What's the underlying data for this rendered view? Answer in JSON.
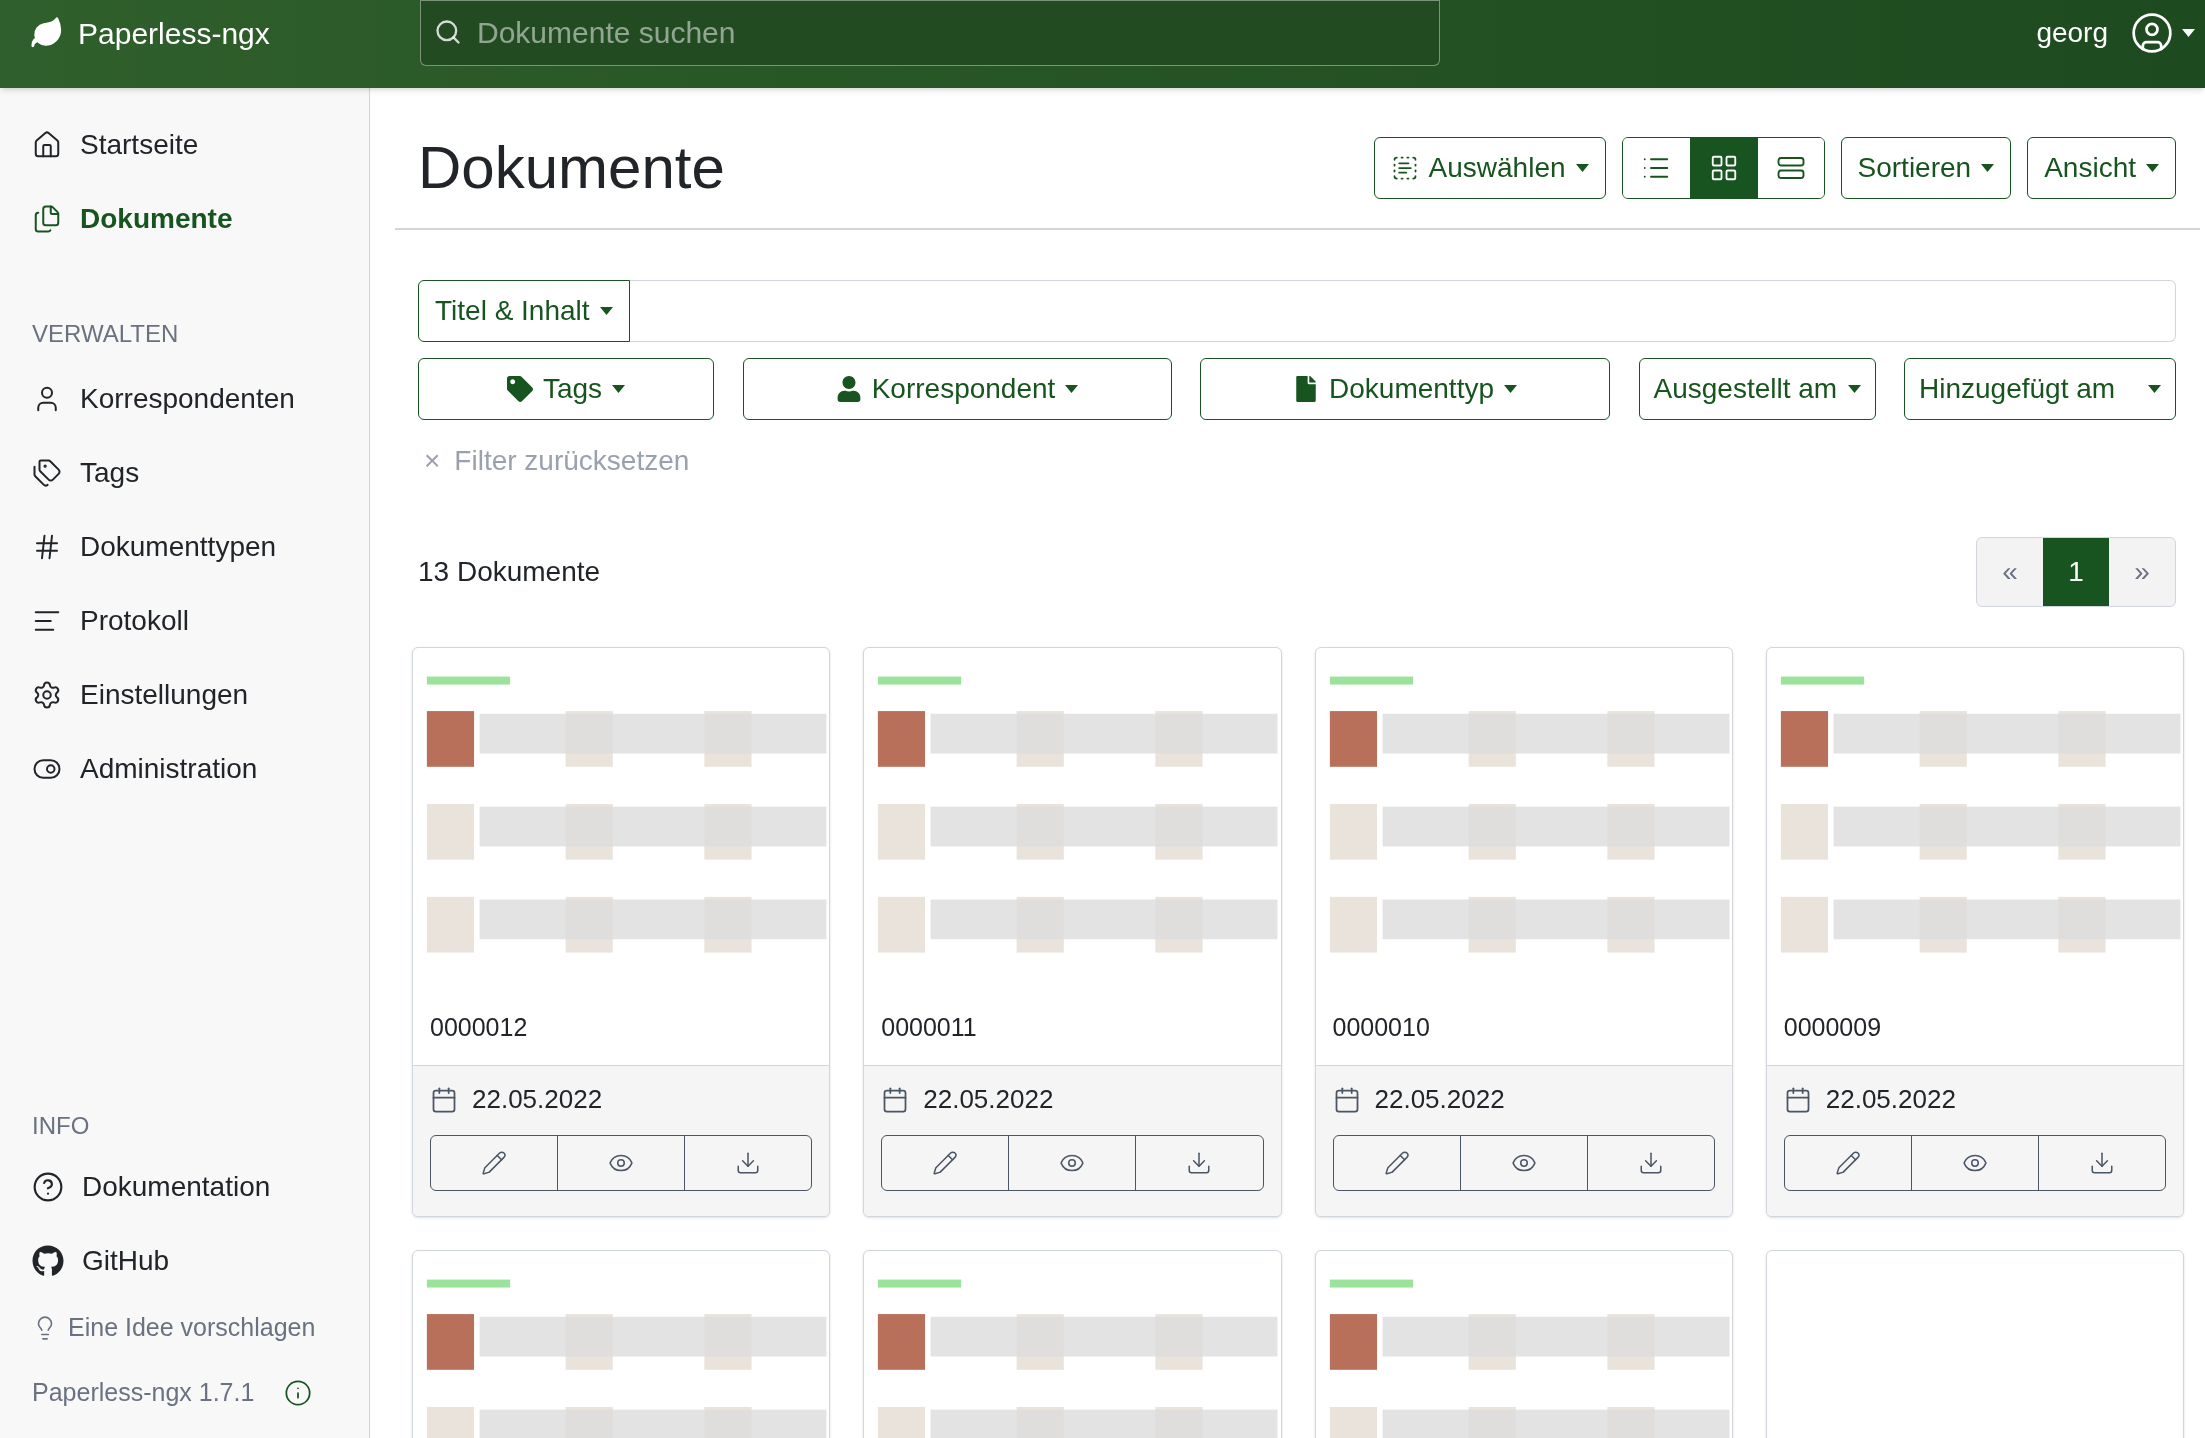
{
  "navbar": {
    "brand": "Paperless-ngx",
    "search": {
      "placeholder": "Dokumente suchen"
    },
    "user": "georg"
  },
  "sidebar": {
    "nav": [
      {
        "label": "Startseite",
        "selected": false
      },
      {
        "label": "Dokumente",
        "selected": true
      }
    ],
    "manage": {
      "heading": "VERWALTEN",
      "items": [
        {
          "label": "Korrespondenten",
          "selected": false
        },
        {
          "label": "Tags",
          "selected": false
        },
        {
          "label": "Dokumenttypen",
          "selected": false
        },
        {
          "label": "Protokoll",
          "selected": false
        },
        {
          "label": "Einstellungen",
          "selected": false
        },
        {
          "label": "Administration",
          "selected": false
        }
      ]
    },
    "info": {
      "heading": "INFO",
      "links": [
        "Dokumentation",
        "GitHub"
      ],
      "idea": "Eine Idee vorschlagen",
      "version": "Paperless-ngx 1.7.1"
    }
  },
  "page": {
    "title": "Dokumente"
  },
  "toolbar": {
    "select": "Auswählen",
    "view_modes": [
      {
        "selected": false
      },
      {
        "selected": true
      },
      {
        "selected": false
      }
    ],
    "sort": "Sortieren",
    "view": "Ansicht"
  },
  "filter": {
    "field_type": "Titel & Inhalt",
    "buttons": [
      "Tags",
      "Korrespondent",
      "Dokumenttyp",
      "Ausgestellt am",
      "Hinzugefügt am"
    ],
    "reset_icon": "×",
    "reset": "Filter zurücksetzen"
  },
  "count": "13 Dokumente",
  "pagination": {
    "prev": "«",
    "pages": [
      {
        "label": "1",
        "selected": true
      }
    ],
    "next": "»"
  },
  "cards": [
    {
      "kind": "document",
      "title": "0000012",
      "date": "22.05.2022"
    },
    {
      "kind": "document",
      "title": "0000011",
      "date": "22.05.2022"
    },
    {
      "kind": "document",
      "title": "0000010",
      "date": "22.05.2022"
    },
    {
      "kind": "document",
      "title": "0000009",
      "date": "22.05.2022"
    },
    {
      "kind": "document"
    },
    {
      "kind": "document"
    },
    {
      "kind": "document"
    },
    {
      "kind": "blank"
    }
  ]
}
